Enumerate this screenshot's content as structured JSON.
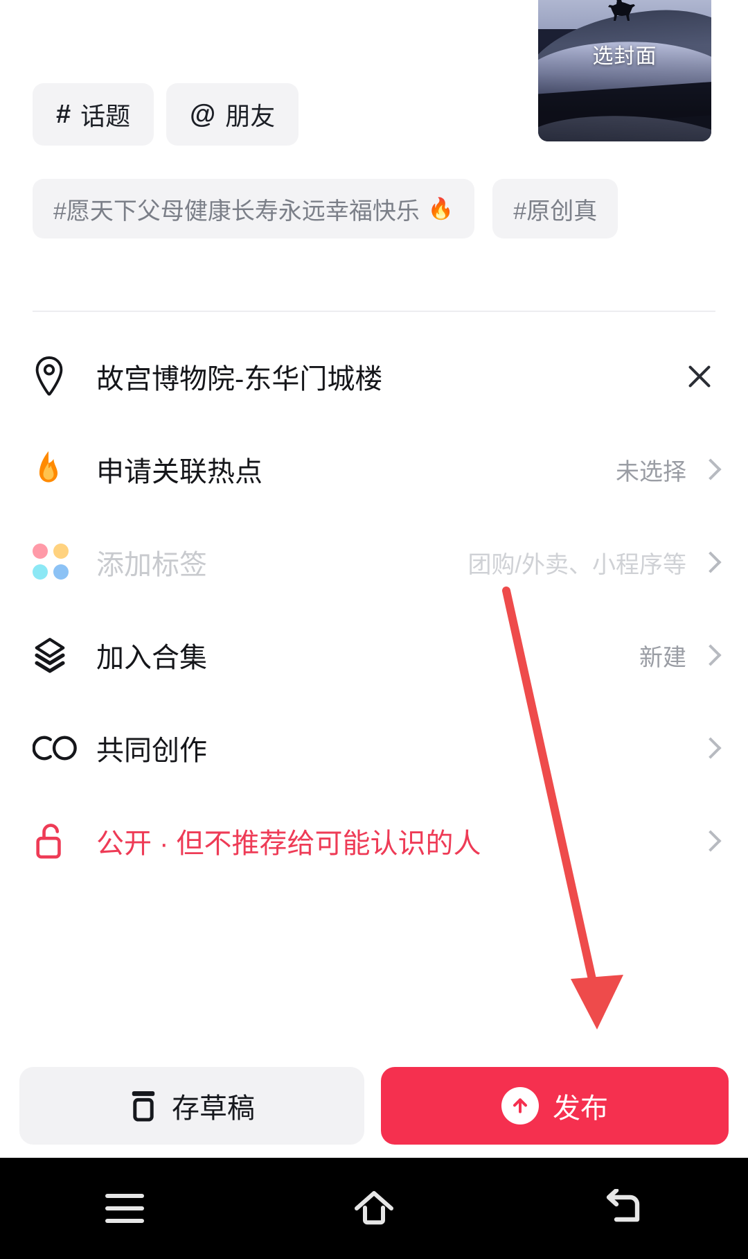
{
  "cover": {
    "label": "选封面",
    "image_description": "horseback-rider-silhouette-on-blue-snow-dunes"
  },
  "chips": [
    {
      "glyph": "#",
      "label": "话题",
      "name": "topic-chip"
    },
    {
      "glyph": "@",
      "label": "朋友",
      "name": "friend-chip"
    }
  ],
  "suggested_tags": [
    {
      "text": "#愿天下父母健康长寿永远幸福快乐",
      "flame": "🔥"
    },
    {
      "text": "#原创真",
      "flame": ""
    }
  ],
  "options": [
    {
      "icon": "location-pin-icon",
      "label": "故宫博物院-东华门城楼",
      "value": "",
      "trailing": "close",
      "state": "normal"
    },
    {
      "icon": "flame-icon",
      "label": "申请关联热点",
      "value": "未选择",
      "trailing": "chevron",
      "state": "normal"
    },
    {
      "icon": "four-dots-icon",
      "label": "添加标签",
      "value": "团购/外卖、小程序等",
      "trailing": "chevron",
      "state": "disabled"
    },
    {
      "icon": "layers-icon",
      "label": "加入合集",
      "value": "新建",
      "trailing": "chevron",
      "state": "normal"
    },
    {
      "icon": "co-icon",
      "label": "共同创作",
      "value": "",
      "trailing": "chevron",
      "state": "normal"
    },
    {
      "icon": "unlock-icon",
      "label": "公开 · 但不推荐给可能认识的人",
      "value": "",
      "trailing": "chevron",
      "state": "danger"
    }
  ],
  "actions": {
    "draft_label": "存草稿",
    "publish_label": "发布"
  },
  "navbar": {
    "recents": "menu-icon",
    "home": "home-icon",
    "back": "back-icon"
  },
  "colors": {
    "accent_red": "#F5304F",
    "danger_text": "#EE3B56",
    "chip_bg": "#F3F3F5",
    "muted_text": "#9A9DA4",
    "annotation_arrow": "#EE4B4B"
  },
  "annotation": {
    "type": "arrow",
    "points_to": "publish-button"
  }
}
